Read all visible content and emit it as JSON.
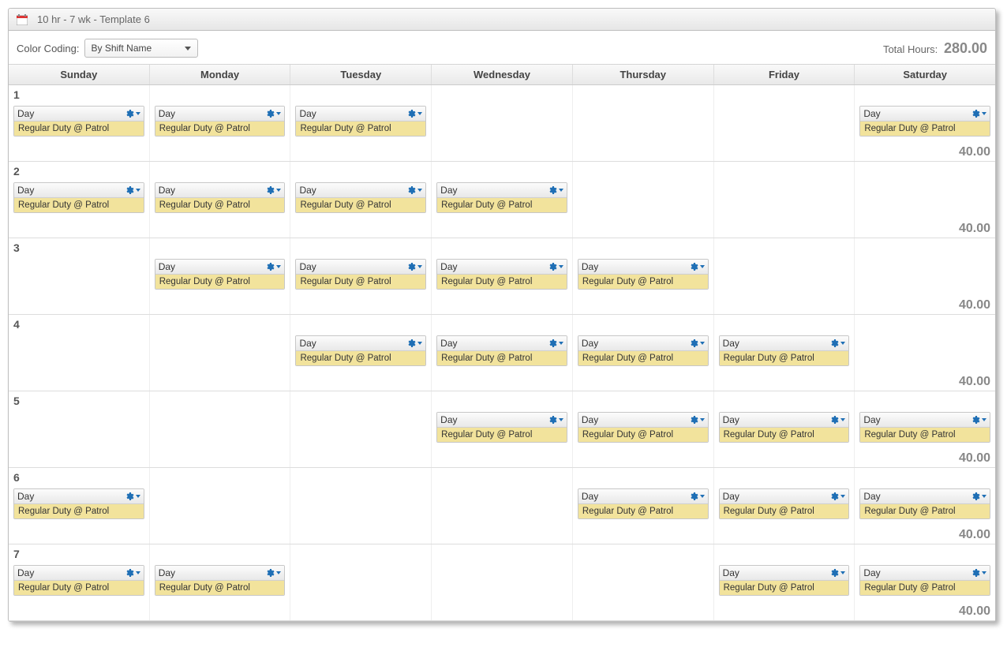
{
  "title": "10 hr - 7 wk - Template 6",
  "colorCodingLabel": "Color Coding:",
  "colorCodingValue": "By Shift Name",
  "totalHoursLabel": "Total Hours:",
  "totalHoursValue": "280.00",
  "days": [
    "Sunday",
    "Monday",
    "Tuesday",
    "Wednesday",
    "Thursday",
    "Friday",
    "Saturday"
  ],
  "shiftName": "Day",
  "shiftDuty": "Regular Duty @ Patrol",
  "weeks": [
    {
      "num": "1",
      "hours": "40.00",
      "cells": [
        true,
        true,
        true,
        false,
        false,
        false,
        true
      ]
    },
    {
      "num": "2",
      "hours": "40.00",
      "cells": [
        true,
        true,
        true,
        true,
        false,
        false,
        false
      ]
    },
    {
      "num": "3",
      "hours": "40.00",
      "cells": [
        false,
        true,
        true,
        true,
        true,
        false,
        false
      ]
    },
    {
      "num": "4",
      "hours": "40.00",
      "cells": [
        false,
        false,
        true,
        true,
        true,
        true,
        false
      ]
    },
    {
      "num": "5",
      "hours": "40.00",
      "cells": [
        false,
        false,
        false,
        true,
        true,
        true,
        true
      ]
    },
    {
      "num": "6",
      "hours": "40.00",
      "cells": [
        true,
        false,
        false,
        false,
        true,
        true,
        true
      ]
    },
    {
      "num": "7",
      "hours": "40.00",
      "cells": [
        true,
        true,
        false,
        false,
        false,
        true,
        true
      ]
    }
  ]
}
